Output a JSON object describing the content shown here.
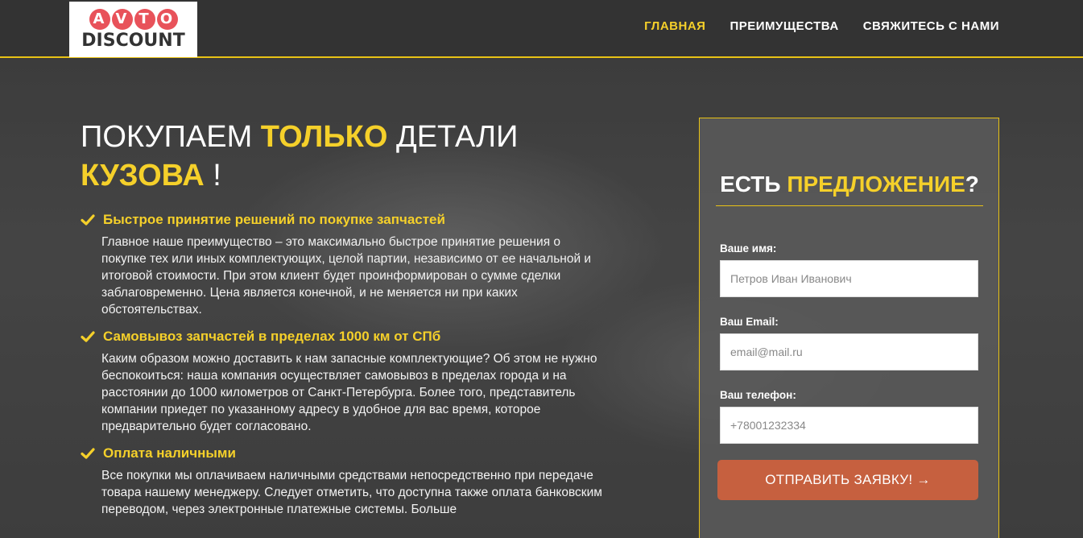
{
  "header": {
    "logo_top": "AVTO",
    "logo_bottom": "DISCOUNT",
    "nav": [
      {
        "label": "ГЛАВНАЯ"
      },
      {
        "label": "ПРЕИМУЩЕСТВА"
      },
      {
        "label": "СВЯЖИТЕСЬ С НАМИ"
      }
    ]
  },
  "hero": {
    "headline": {
      "part1": "ПОКУПАЕМ ",
      "highlight1": "ТОЛЬКО",
      "part2": " ДЕТАЛИ",
      "highlight2": "КУЗОВА",
      "part3": " !"
    },
    "features": [
      {
        "icon": "check-icon",
        "title": "Быстрое принятие решений по покупке запчастей",
        "text": "Главное наше преимущество – это максимально быстрое принятие решения о покупке тех или иных комплектующих, целой партии, независимо от ее начальной и итоговой стоимости. При этом клиент будет проинформирован о сумме сделки заблаговременно. Цена является конечной, и не меняется ни при каких обстоятельствах."
      },
      {
        "icon": "check-icon",
        "title": "Самовывоз запчастей в пределах 1000 км от СПб",
        "text": "Каким образом можно доставить к нам запасные комплектующие? Об этом не нужно беспокоиться: наша компания осуществляет самовывоз в пределах города и на расстоянии до 1000 километров от Санкт-Петербурга. Более того, представитель компании приедет по указанному адресу в удобное для вас время, которое предварительно будет согласовано."
      },
      {
        "icon": "check-icon",
        "title": "Оплата наличными",
        "text": "Все покупки мы оплачиваем наличными средствами непосредственно при передаче товара нашему менеджеру. Следует отметить, что доступна также оплата банковским переводом, через электронные платежные системы. Больше"
      }
    ]
  },
  "form": {
    "title_part1": "ЕСТЬ ",
    "title_highlight": "ПРЕДЛОЖЕНИЕ",
    "title_part2": "?",
    "name_label": "Ваше имя:",
    "name_placeholder": "Петров Иван Иванович",
    "email_label": "Ваш Email:",
    "email_placeholder": "email@mail.ru",
    "phone_label": "Ваш телефон:",
    "phone_placeholder": "+78001232334",
    "submit_label": "ОТПРАВИТЬ ЗАЯВКУ! →"
  },
  "colors": {
    "accent": "#f5d02a",
    "button": "#c6603f",
    "header_bg": "#333333"
  }
}
